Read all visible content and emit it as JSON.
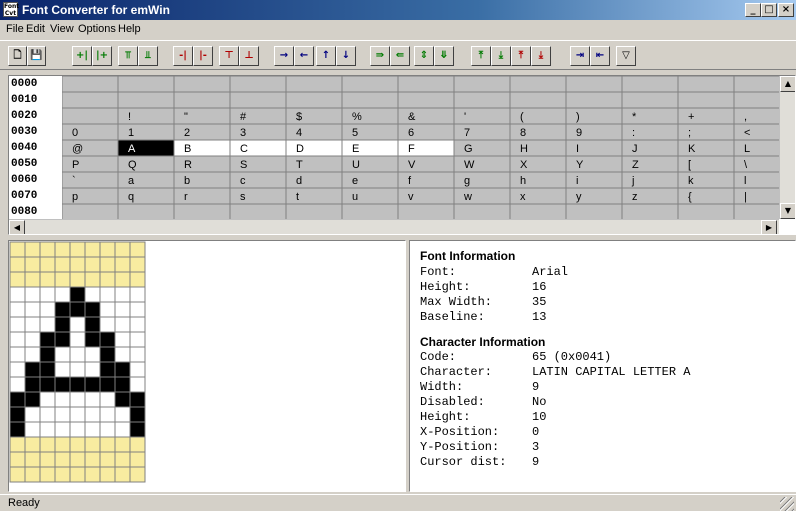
{
  "window": {
    "title": "Font Converter for emWin",
    "app_icon_label": "Font Cvt",
    "controls": {
      "minimize": "_",
      "maximize": "□",
      "close": "×"
    }
  },
  "menu": [
    "File",
    "Edit",
    "View",
    "Options",
    "Help"
  ],
  "toolbar": {
    "buttons": [
      {
        "name": "new-file",
        "glyph": "🗋",
        "color": "#000000"
      },
      {
        "name": "save-file",
        "glyph": "💾",
        "color": "#000000"
      },
      {
        "name": "insert-left-col",
        "glyph": "+|",
        "color": "#007a00"
      },
      {
        "name": "insert-right-col",
        "glyph": "|+",
        "color": "#007a00"
      },
      {
        "name": "insert-top-row",
        "glyph": "⫪",
        "color": "#007a00"
      },
      {
        "name": "insert-bottom-row",
        "glyph": "⫫",
        "color": "#007a00"
      },
      {
        "name": "delete-left-col",
        "glyph": "-|",
        "color": "#b00000"
      },
      {
        "name": "delete-right-col",
        "glyph": "|-",
        "color": "#b00000"
      },
      {
        "name": "delete-top-row",
        "glyph": "⊤",
        "color": "#b00000"
      },
      {
        "name": "delete-bottom-row",
        "glyph": "⊥",
        "color": "#b00000"
      },
      {
        "name": "shift-right",
        "glyph": "→",
        "color": "#000080"
      },
      {
        "name": "shift-left",
        "glyph": "←",
        "color": "#000080"
      },
      {
        "name": "shift-up",
        "glyph": "↑",
        "color": "#000080"
      },
      {
        "name": "shift-down",
        "glyph": "↓",
        "color": "#000080"
      },
      {
        "name": "enlarge-right",
        "glyph": "⇛",
        "color": "#007a00"
      },
      {
        "name": "enlarge-left",
        "glyph": "⇚",
        "color": "#007a00"
      },
      {
        "name": "enlarge-vertical",
        "glyph": "⇕",
        "color": "#007a00"
      },
      {
        "name": "shrink-vertical",
        "glyph": "⤋",
        "color": "#007a00"
      },
      {
        "name": "enlarge-top",
        "glyph": "⤒",
        "color": "#007a00"
      },
      {
        "name": "enlarge-bottom",
        "glyph": "⤓",
        "color": "#007a00"
      },
      {
        "name": "reduce-top",
        "glyph": "⤒",
        "color": "#b00000"
      },
      {
        "name": "reduce-bottom",
        "glyph": "⤓",
        "color": "#b00000"
      },
      {
        "name": "move-to-right",
        "glyph": "⇥",
        "color": "#000080"
      },
      {
        "name": "move-to-left",
        "glyph": "⇤",
        "color": "#000080"
      },
      {
        "name": "filter",
        "glyph": "▽",
        "color": "#000000"
      }
    ]
  },
  "grid": {
    "rows": [
      {
        "label": "0000",
        "cells": [
          "",
          "",
          "",
          "",
          "",
          "",
          "",
          "",
          "",
          "",
          "",
          "",
          ""
        ]
      },
      {
        "label": "0010",
        "cells": [
          "",
          "",
          "",
          "",
          "",
          "",
          "",
          "",
          "",
          "",
          "",
          "",
          ""
        ]
      },
      {
        "label": "0020",
        "cells": [
          "",
          "!",
          "\"",
          "#",
          "$",
          "%",
          "&",
          "'",
          "(",
          ")",
          "*",
          "+",
          ","
        ]
      },
      {
        "label": "0030",
        "cells": [
          "0",
          "1",
          "2",
          "3",
          "4",
          "5",
          "6",
          "7",
          "8",
          "9",
          ":",
          ";",
          "<"
        ]
      },
      {
        "label": "0040",
        "cells": [
          "@",
          "A",
          "B",
          "C",
          "D",
          "E",
          "F",
          "G",
          "H",
          "I",
          "J",
          "K",
          "L"
        ]
      },
      {
        "label": "0050",
        "cells": [
          "P",
          "Q",
          "R",
          "S",
          "T",
          "U",
          "V",
          "W",
          "X",
          "Y",
          "Z",
          "[",
          "\\"
        ]
      },
      {
        "label": "0060",
        "cells": [
          "`",
          "a",
          "b",
          "c",
          "d",
          "e",
          "f",
          "g",
          "h",
          "i",
          "j",
          "k",
          "l"
        ]
      },
      {
        "label": "0070",
        "cells": [
          "p",
          "q",
          "r",
          "s",
          "t",
          "u",
          "v",
          "w",
          "x",
          "y",
          "z",
          "{",
          "|"
        ]
      },
      {
        "label": "0080",
        "cells": [
          "",
          "",
          "",
          "",
          "",
          "",
          "",
          "",
          "",
          "",
          "",
          "",
          ""
        ]
      }
    ],
    "selected": {
      "row": 4,
      "col": 1
    },
    "enabled_in_row": {
      "row": 4,
      "cols": [
        2,
        3,
        4,
        5,
        6
      ]
    },
    "colors": {
      "cell": "#c0c0c0",
      "selected": "#000000",
      "enabled": "#ffffff",
      "line": "#808080"
    }
  },
  "bitmap": {
    "rows": [
      "000000000",
      "000000000",
      "000000000",
      "000010000",
      "000111000",
      "000101000",
      "001101100",
      "001000100",
      "011000110",
      "011111110",
      "110000011",
      "100000001",
      "100000001",
      "000000000",
      "000000000",
      "000000000"
    ],
    "char_rows_range": [
      3,
      12
    ],
    "colors": {
      "on": "#000000",
      "off": "#ffffff",
      "outside": "#f8eca0",
      "grid": "#808080"
    }
  },
  "info": {
    "font_heading": "Font Information",
    "font_fields": [
      {
        "key": "Font:",
        "value": "Arial"
      },
      {
        "key": "Height:",
        "value": "16"
      },
      {
        "key": "Max Width:",
        "value": "35"
      },
      {
        "key": "Baseline:",
        "value": "13"
      }
    ],
    "char_heading": "Character Information",
    "char_fields": [
      {
        "key": "Code:",
        "value": "65 (0x0041)"
      },
      {
        "key": "Character:",
        "value": "LATIN CAPITAL LETTER A"
      },
      {
        "key": "Width:",
        "value": "9"
      },
      {
        "key": "Disabled:",
        "value": "No"
      },
      {
        "key": "Height:",
        "value": "10"
      },
      {
        "key": "X-Position:",
        "value": "0"
      },
      {
        "key": "Y-Position:",
        "value": "3"
      },
      {
        "key": "Cursor dist:",
        "value": "9"
      }
    ]
  },
  "status": "Ready"
}
